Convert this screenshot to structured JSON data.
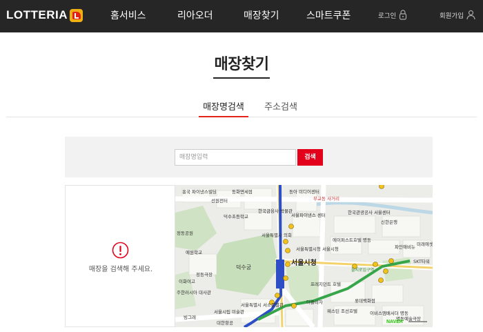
{
  "header": {
    "logo_text": "LOTTERIA",
    "nav": [
      "홈서비스",
      "리아오더",
      "매장찾기",
      "스마트쿠폰"
    ],
    "login_label": "로그인",
    "join_label": "회원가입",
    "background_color": "#262626"
  },
  "page": {
    "title": "매장찾기"
  },
  "tabs": [
    {
      "label": "매장명검색",
      "active": true
    },
    {
      "label": "주소검색",
      "active": false
    }
  ],
  "search": {
    "placeholder": "매장명입력",
    "value": "",
    "button_label": "검색",
    "accent_color": "#e2001a"
  },
  "result": {
    "message": "매장을 검색해 주세요.",
    "icon": "alert-circle-icon"
  },
  "map": {
    "center_label": "서울시청",
    "labels": [
      "홍국 파이낸스빌딩",
      "선원전터",
      "동화면세점",
      "동아 미디어센터",
      "무교동 사거리",
      "한국관광공사 서울센터",
      "신한은행",
      "덕수초등학교",
      "한국금융사 박물관",
      "서울파이낸스 센터",
      "서울특별시 의회",
      "정동공원",
      "예원학교",
      "서울특별시청 서울시청",
      "에이퍼스트호텔 명동",
      "파인애비뉴",
      "미래에셋 센터원",
      "SKT타워",
      "덕수궁",
      "정동극장",
      "이화여고",
      "주한러시아 대사관",
      "프레지던트 호텔",
      "롯데백화점",
      "서울특별시 서소문별관",
      "더플라자",
      "서울시립 미술관",
      "빙그레",
      "대한항공",
      "웨스틴 조선호텔",
      "이비스앰배서더 명동",
      "명동예술극장",
      "을지로입구역",
      "NAVER"
    ]
  }
}
